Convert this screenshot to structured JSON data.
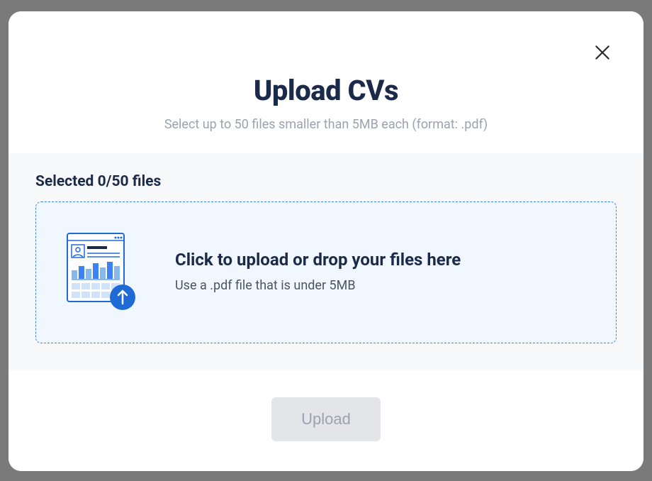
{
  "modal": {
    "title": "Upload CVs",
    "subtitle": "Select up to 50 files smaller than 5MB each (format: .pdf)",
    "selected_label": "Selected 0/50 files",
    "dropzone": {
      "title": "Click to upload or drop your files here",
      "hint": "Use a .pdf file that is under 5MB"
    },
    "upload_button_label": "Upload"
  }
}
